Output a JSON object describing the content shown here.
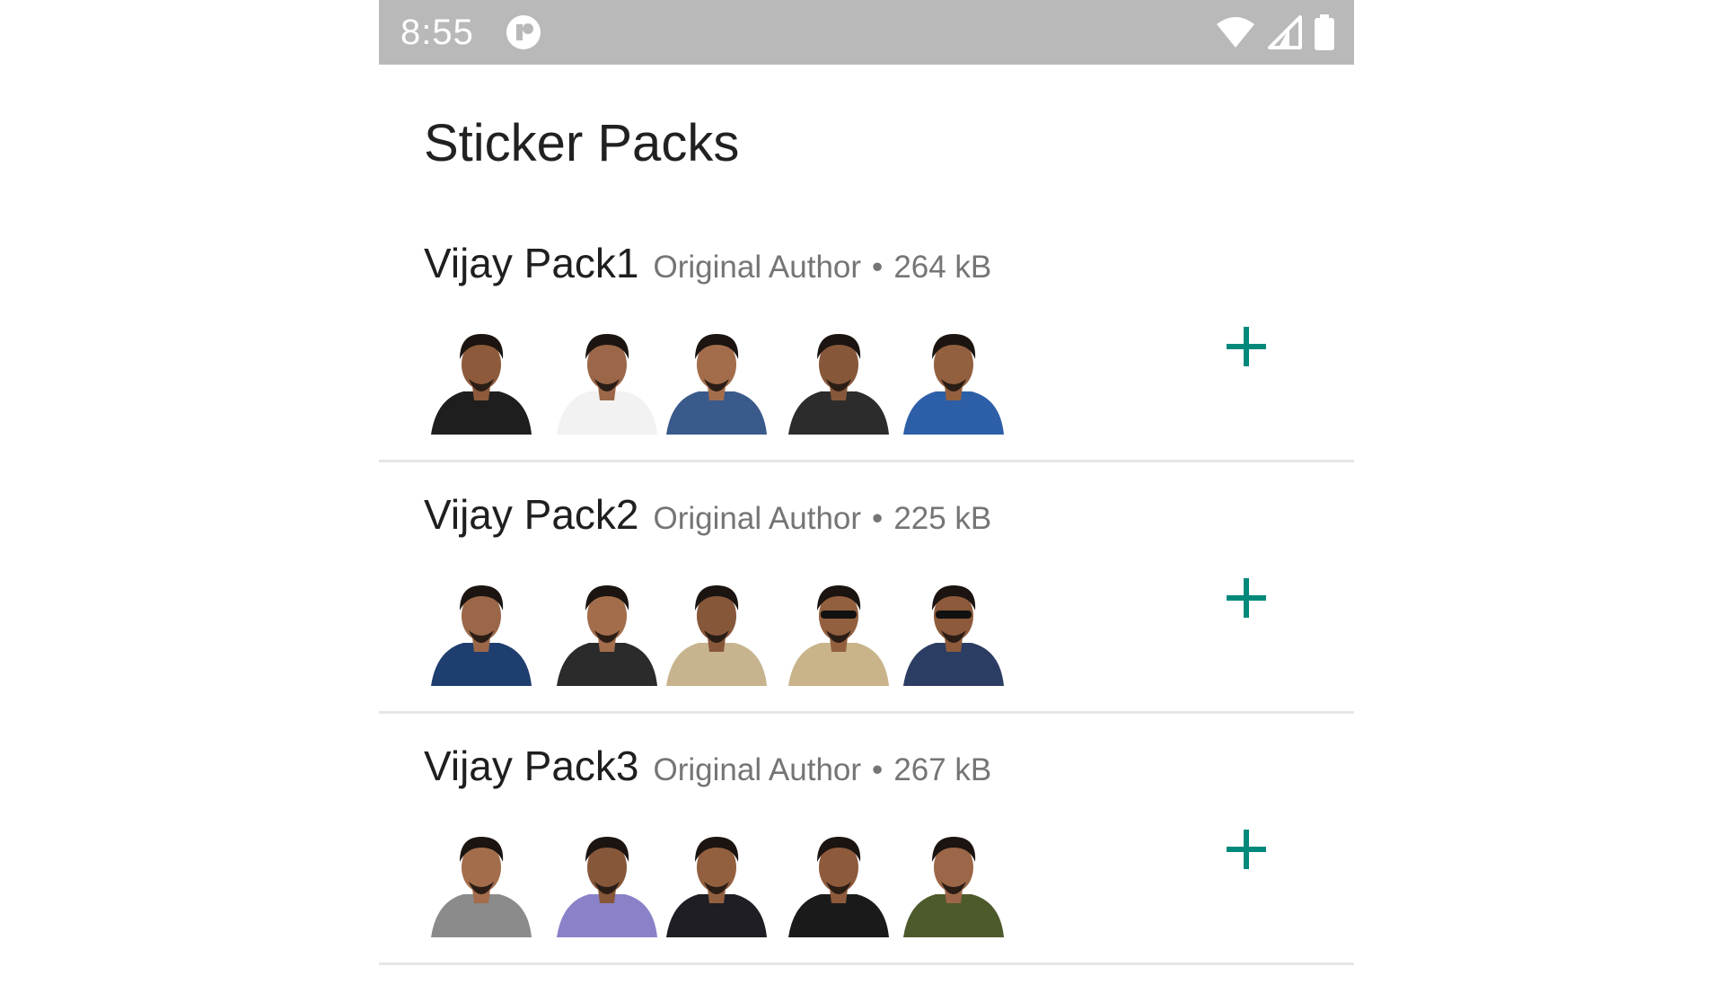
{
  "status_bar": {
    "time": "8:55",
    "app_icon": "notification-app-icon",
    "wifi_icon": "wifi-icon",
    "signal_icon": "cellular-signal-icon",
    "battery_icon": "battery-icon",
    "background": "#b9b9b9"
  },
  "page": {
    "title": "Sticker Packs"
  },
  "accent_color": "#00897b",
  "packs": [
    {
      "name": "Vijay Pack1",
      "author": "Original Author",
      "separator": "•",
      "size": "264 kB",
      "add_icon": "plus-icon",
      "stickers": [
        "sticker-portrait",
        "sticker-portrait",
        "sticker-portrait",
        "sticker-portrait",
        "sticker-portrait"
      ]
    },
    {
      "name": "Vijay Pack2",
      "author": "Original Author",
      "separator": "•",
      "size": "225 kB",
      "add_icon": "plus-icon",
      "stickers": [
        "sticker-portrait",
        "sticker-portrait",
        "sticker-portrait",
        "sticker-portrait",
        "sticker-portrait"
      ]
    },
    {
      "name": "Vijay Pack3",
      "author": "Original Author",
      "separator": "•",
      "size": "267 kB",
      "add_icon": "plus-icon",
      "stickers": [
        "sticker-portrait",
        "sticker-portrait",
        "sticker-portrait",
        "sticker-portrait",
        "sticker-portrait"
      ]
    }
  ]
}
